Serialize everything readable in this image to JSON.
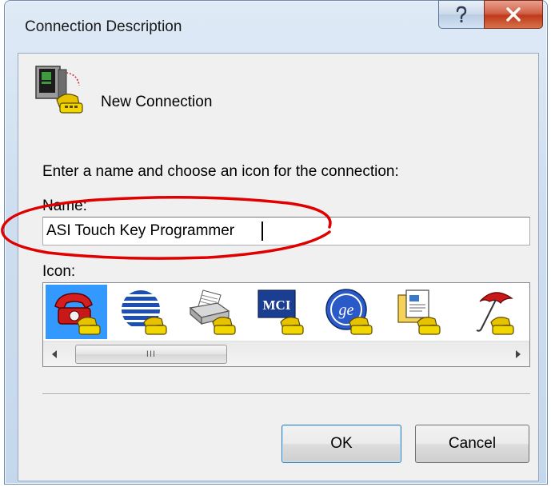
{
  "window": {
    "title": "Connection Description",
    "help_glyph": "?",
    "close_glyph": "X"
  },
  "heading": {
    "icon": "computer-phone-icon",
    "label": "New Connection"
  },
  "form": {
    "instruction": "Enter a name and choose an icon for the connection:",
    "name_label": "Name:",
    "name_value": "ASI Touch Key Programmer",
    "icon_label": "Icon:"
  },
  "icons": [
    {
      "name": "red-telephone-icon",
      "selected": true
    },
    {
      "name": "globe-lines-icon",
      "selected": false
    },
    {
      "name": "fax-machine-icon",
      "selected": false
    },
    {
      "name": "mci-logo-icon",
      "selected": false
    },
    {
      "name": "ge-logo-icon",
      "selected": false
    },
    {
      "name": "documents-icon",
      "selected": false
    },
    {
      "name": "umbrella-icon",
      "selected": false
    }
  ],
  "scrollbar": {
    "grip": "III",
    "left_arrow": "◀",
    "right_arrow": "▶"
  },
  "buttons": {
    "ok": "OK",
    "cancel": "Cancel"
  },
  "colors": {
    "selection": "#3399ff",
    "annotation": "#e00000"
  }
}
